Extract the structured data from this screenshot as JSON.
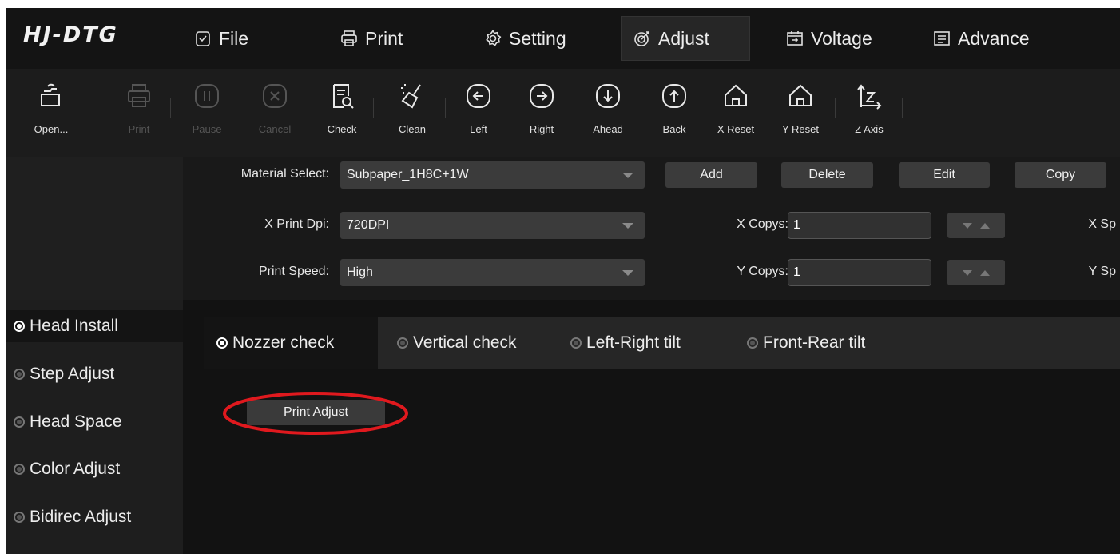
{
  "app": {
    "brand": "HJ-DTG"
  },
  "menu": [
    {
      "label": "File",
      "icon": "clipboard-check-icon"
    },
    {
      "label": "Print",
      "icon": "printer-icon"
    },
    {
      "label": "Setting",
      "icon": "gear-icon"
    },
    {
      "label": "Adjust",
      "icon": "target-icon",
      "active": true
    },
    {
      "label": "Voltage",
      "icon": "calendar-icon"
    },
    {
      "label": "Advance",
      "icon": "list-icon"
    }
  ],
  "toolbar": {
    "open": "Open...",
    "print": "Print",
    "pause": "Pause",
    "cancel": "Cancel",
    "check": "Check",
    "clean": "Clean",
    "left": "Left",
    "right": "Right",
    "ahead": "Ahead",
    "back": "Back",
    "x_reset": "X Reset",
    "y_reset": "Y Reset",
    "z_axis": "Z Axis"
  },
  "settings": {
    "material_label": "Material Select:",
    "material_value": "Subpaper_1H8C+1W",
    "add": "Add",
    "delete": "Delete",
    "edit": "Edit",
    "copy": "Copy",
    "xdpi_label": "X Print Dpi:",
    "xdpi_value": "720DPI",
    "speed_label": "Print Speed:",
    "speed_value": "High",
    "xcopys_label": "X Copys:",
    "xcopys_value": "1",
    "ycopys_label": "Y Copys:",
    "ycopys_value": "1",
    "xsp_label": "X Sp",
    "ysp_label": "Y Sp"
  },
  "sidebar": {
    "items": [
      {
        "label": "Head Install",
        "active": true
      },
      {
        "label": "Step Adjust"
      },
      {
        "label": "Head Space"
      },
      {
        "label": "Color Adjust"
      },
      {
        "label": "Bidirec Adjust"
      }
    ]
  },
  "tabs": [
    {
      "label": "Nozzer check",
      "active": true
    },
    {
      "label": "Vertical check"
    },
    {
      "label": "Left-Right tilt"
    },
    {
      "label": "Front-Rear tilt"
    }
  ],
  "main": {
    "print_adjust": "Print Adjust"
  },
  "colors": {
    "background": "#151515",
    "highlight": "#e0191e",
    "text": "#e6e6e6"
  }
}
